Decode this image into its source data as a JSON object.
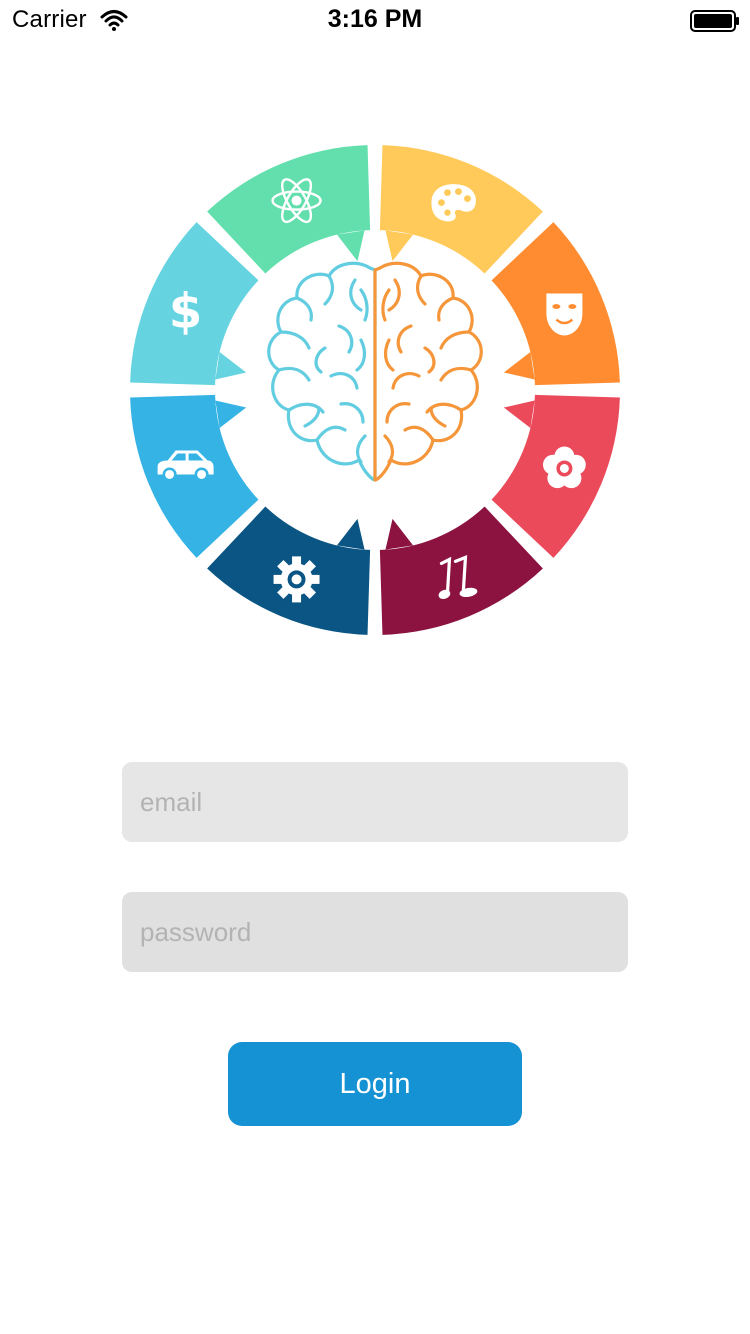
{
  "status_bar": {
    "carrier": "Carrier",
    "time": "3:16 PM"
  },
  "logo": {
    "segments": [
      {
        "icon": "atom-icon",
        "color": "#63dfae"
      },
      {
        "icon": "palette-icon",
        "color": "#ffca5a"
      },
      {
        "icon": "mask-icon",
        "color": "#ff8c30"
      },
      {
        "icon": "flower-icon",
        "color": "#eb4a5b"
      },
      {
        "icon": "music-note-icon",
        "color": "#8c1240"
      },
      {
        "icon": "gear-icon",
        "color": "#0a5584"
      },
      {
        "icon": "car-icon",
        "color": "#35b3e5"
      },
      {
        "icon": "dollar-icon",
        "color": "#66d4e0"
      }
    ],
    "brain_left_color": "#62cde0",
    "brain_right_color": "#f5963a"
  },
  "form": {
    "email_placeholder": "email",
    "password_placeholder": "password",
    "login_label": "Login"
  },
  "colors": {
    "login_button": "#1592d3",
    "field_background": "#e6e6e6"
  }
}
